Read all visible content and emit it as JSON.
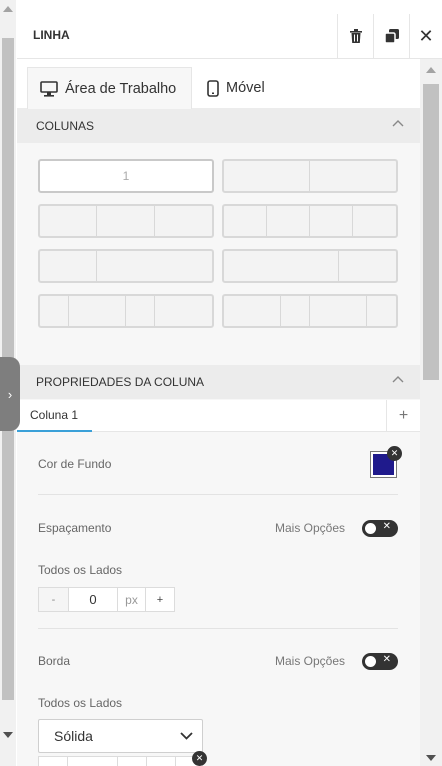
{
  "header": {
    "title": "LINHA"
  },
  "device_tabs": [
    {
      "label": "Área de Trabalho",
      "active": true
    },
    {
      "label": "Móvel",
      "active": false
    }
  ],
  "columns_section": {
    "title": "COLUNAS",
    "selected_layout_label": "1"
  },
  "column_props_section": {
    "title": "PROPRIEDADES DA COLUNA",
    "tab": "Coluna 1",
    "add_symbol": "+"
  },
  "background": {
    "label": "Cor de Fundo",
    "color": "#1f1a8c"
  },
  "spacing": {
    "label": "Espaçamento",
    "more_options": "Mais Opções",
    "all_sides_label": "Todos os Lados",
    "value": "0",
    "unit": "px",
    "minus": "-",
    "plus": "+"
  },
  "border": {
    "label": "Borda",
    "more_options": "Mais Opções",
    "all_sides_label": "Todos os Lados",
    "style": "Sólida"
  },
  "colors": {
    "accent": "#3aa0d8",
    "toggle": "#333333"
  }
}
